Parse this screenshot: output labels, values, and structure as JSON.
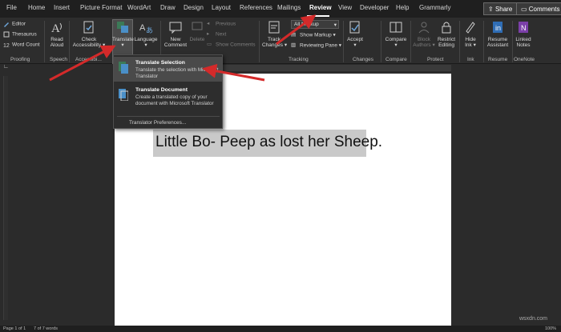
{
  "tabs": [
    "File",
    "Home",
    "Insert",
    "Picture Format",
    "WordArt",
    "Draw",
    "Design",
    "Layout",
    "References",
    "Mailings",
    "Review",
    "View",
    "Developer",
    "Help",
    "Grammarly"
  ],
  "active_tab": "Review",
  "top_buttons": {
    "share": "Share",
    "comments": "Comments"
  },
  "ribbon": {
    "proofing": {
      "editor": "Editor",
      "thesaurus": "Thesaurus",
      "word_count": "Word Count",
      "label": "Proofing"
    },
    "speech": {
      "read_aloud_1": "Read",
      "read_aloud_2": "Aloud",
      "label": "Speech"
    },
    "accessibility": {
      "check_1": "Check",
      "check_2": "Accessibility ▾",
      "label": "Accessibi..."
    },
    "language": {
      "translate_1": "Translate",
      "translate_2": "▾",
      "language_1": "Language",
      "language_2": "▾"
    },
    "comments": {
      "new_1": "New",
      "new_2": "Comment",
      "delete": "Delete",
      "previous": "Previous",
      "next": "Next",
      "show": "Show Comments"
    },
    "tracking": {
      "track_1": "Track",
      "track_2": "Changes ▾",
      "markup_value": "All Markup",
      "show_markup": "Show Markup ▾",
      "reviewing_pane": "Reviewing Pane ▾",
      "label": "Tracking"
    },
    "changes": {
      "accept_1": "Accept",
      "accept_2": "▾",
      "label": "Changes"
    },
    "compare": {
      "compare_1": "Compare",
      "compare_2": "▾",
      "label": "Compare"
    },
    "protect": {
      "block_1": "Block",
      "block_2": "Authors ▾",
      "restrict_1": "Restrict",
      "restrict_2": "Editing",
      "label": "Protect"
    },
    "ink": {
      "hide_1": "Hide",
      "hide_2": "Ink ▾",
      "label": "Ink"
    },
    "resume": {
      "resume_1": "Resume",
      "resume_2": "Assistant",
      "label": "Resume"
    },
    "onenote": {
      "linked_1": "Linked",
      "linked_2": "Notes",
      "label": "OneNote"
    }
  },
  "translate_menu": {
    "selection_title": "Translate Selection",
    "selection_desc": "Translate the selection with Microsoft Translator",
    "document_title": "Translate Document",
    "document_desc": "Create a translated copy of your document with Microsoft Translator",
    "preferences": "Translator Preferences..."
  },
  "document": {
    "text": "Little Bo- Peep as lost her Sheep."
  },
  "status": {
    "page": "Page 1 of 1",
    "words": "7 of 7 words",
    "zoom": "100%"
  },
  "watermark": "wsxdn.com",
  "colors": {
    "accent_arrow": "#d42a2a",
    "page": "#ffffff",
    "selection": "#c9c9c9",
    "ribbon": "#2d2d2d"
  }
}
